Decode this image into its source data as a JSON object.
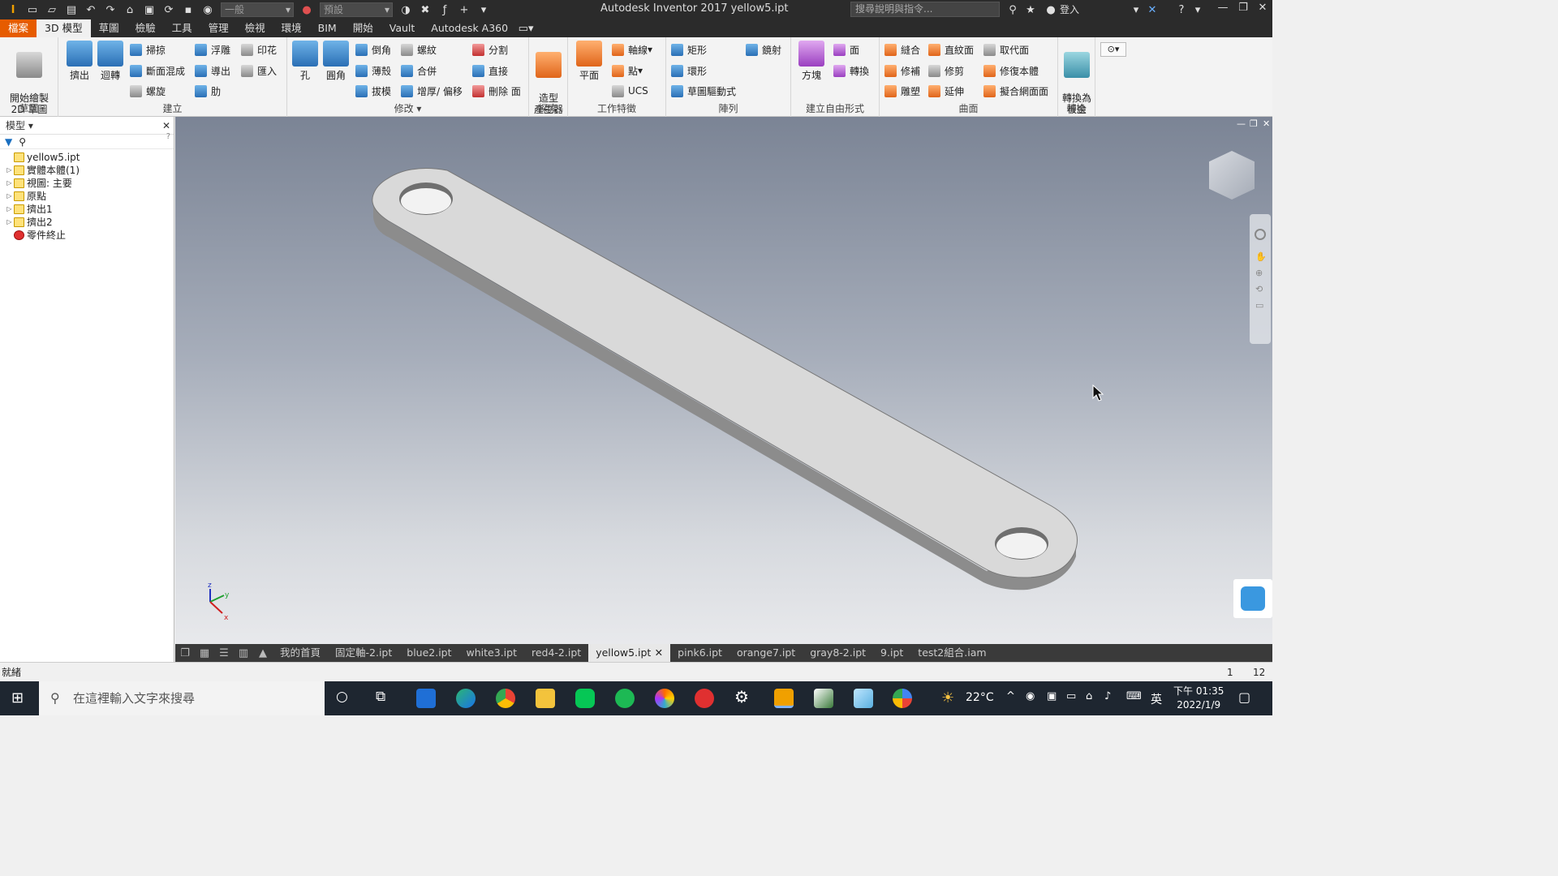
{
  "titlebar": {
    "app_title": "Autodesk Inventor 2017    yellow5.ipt",
    "appearance_dropdown": "一般",
    "material_dropdown": "預設",
    "search_placeholder": "搜尋說明與指令...",
    "sign_in": "登入"
  },
  "tabs": [
    "檔案",
    "3D 模型",
    "草圖",
    "檢驗",
    "工具",
    "管理",
    "檢視",
    "環境",
    "BIM",
    "開始",
    "Vault",
    "Autodesk A360"
  ],
  "ribbon": {
    "sketch": {
      "title": "草圖",
      "start_sketch": "開始繪製\n2D 草圖"
    },
    "create": {
      "title": "建立",
      "extrude": "擠出",
      "revolve": "迴轉",
      "sweep": "掃掠",
      "loft": "斷面混成",
      "coil": "螺旋",
      "emboss": "浮雕",
      "derive": "導出",
      "rib": "肋",
      "decal": "印花",
      "import": "匯入"
    },
    "modify": {
      "title": "修改",
      "hole": "孔",
      "fillet": "圓角",
      "chamfer": "倒角",
      "shell": "薄殼",
      "draft": "拔模",
      "thread": "螺紋",
      "combine": "合併",
      "thicken": "增厚/ 偏移",
      "split": "分割",
      "direct": "直接",
      "delete_face": "刪除 面"
    },
    "explore": {
      "title": "探索",
      "shape_gen": "造型\n產生器"
    },
    "work_features": {
      "title": "工作特徵",
      "plane": "平面",
      "axis": "軸線",
      "point": "點",
      "ucs": "UCS"
    },
    "pattern": {
      "title": "陣列",
      "rect": "矩形",
      "circular": "環形",
      "sketch_driven": "草圖驅動式",
      "mirror": "鏡射"
    },
    "freeform": {
      "title": "建立自由形式",
      "box": "方塊",
      "face": "面",
      "convert": "轉換"
    },
    "surface": {
      "title": "曲面",
      "stitch": "縫合",
      "patch": "修補",
      "sculpt": "雕塑",
      "ruled": "直紋面",
      "trim": "修剪",
      "extend": "延伸",
      "replace_face": "取代面",
      "repair": "修復本體",
      "fit_mesh": "擬合網面面"
    },
    "convert": {
      "title": "轉換",
      "to_sheet": "轉換為\n板金"
    }
  },
  "browser": {
    "header": "模型",
    "tree": [
      {
        "label": "yellow5.ipt",
        "indent": 0,
        "expand": false
      },
      {
        "label": "實體本體(1)",
        "indent": 1,
        "expand": true
      },
      {
        "label": "視圖: 主要",
        "indent": 1,
        "expand": true
      },
      {
        "label": "原點",
        "indent": 1,
        "expand": true
      },
      {
        "label": "擠出1",
        "indent": 1,
        "expand": true
      },
      {
        "label": "擠出2",
        "indent": 1,
        "expand": true
      },
      {
        "label": "零件終止",
        "indent": 1,
        "expand": false
      }
    ]
  },
  "doc_tabs": [
    "我的首頁",
    "固定軸-2.ipt",
    "blue2.ipt",
    "white3.ipt",
    "red4-2.ipt",
    "yellow5.ipt",
    "pink6.ipt",
    "orange7.ipt",
    "gray8-2.ipt",
    "9.ipt",
    "test2組合.iam"
  ],
  "active_doc": "yellow5.ipt",
  "status": {
    "text": "就緒",
    "count1": "1",
    "count2": "12"
  },
  "taskbar": {
    "search_placeholder": "在這裡輸入文字來搜尋",
    "weather": "22°C",
    "ime": "英",
    "time": "下午 01:35",
    "date": "2022/1/9"
  },
  "colors": {
    "file_tab": "#e65c00",
    "title_bg": "#2b2b2b",
    "taskbar_bg": "#1e2630"
  }
}
